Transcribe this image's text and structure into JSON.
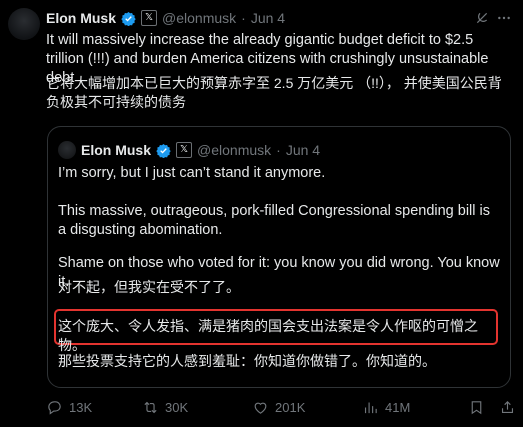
{
  "tweet": {
    "author_name": "Elon Musk",
    "handle": "@elonmusk",
    "separator": "·",
    "date": "Jun 4",
    "text_en": "It will massively increase the already gigantic budget deficit to $2.5 trillion (!!!) and burden America citizens with crushingly unsustainable debt",
    "text_zh": "它将大幅增加本已巨大的预算赤字至 2.5 万亿美元 （!!）， 并使美国公民背负极其不可持续的债务"
  },
  "quoted": {
    "author_name": "Elon Musk",
    "handle": "@elonmusk",
    "separator": "·",
    "date": "Jun 4",
    "p1": "I’m sorry, but I just can’t stand it anymore.",
    "p2": "This massive, outrageous, pork-filled Congressional spending bill is a disgusting abomination.",
    "p3": "Shame on those who voted for it: you know you did wrong. You know it.",
    "zh1": "对不起，但我实在受不了了。",
    "zh2": "这个庞大、令人发指、满是猪肉的国会支出法案是令人作呕的可憎之物。",
    "zh3": "那些投票支持它的人感到羞耻：你知道你做错了。你知道的。"
  },
  "actions": {
    "replies": "13K",
    "reposts": "30K",
    "likes": "201K",
    "views": "41M"
  },
  "icons": [
    "verified-badge-icon",
    "x-affiliation-icon",
    "grok-icon",
    "more-icon",
    "reply-icon",
    "repost-icon",
    "like-icon",
    "views-icon",
    "bookmark-icon",
    "share-icon"
  ],
  "colors": {
    "background": "#000000",
    "text": "#e7e9ea",
    "muted": "#71767b",
    "verified": "#1d9bf0",
    "highlight_box": "#e3342f",
    "border": "#2f3336"
  }
}
